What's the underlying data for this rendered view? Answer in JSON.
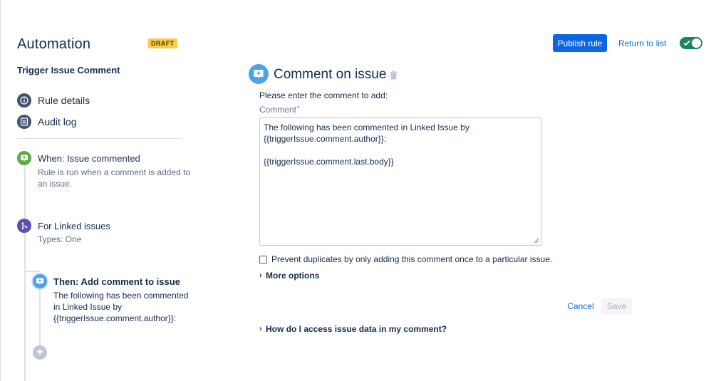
{
  "header": {
    "title": "Automation",
    "badge": "DRAFT",
    "rule_name": "Trigger Issue Comment",
    "publish_label": "Publish rule",
    "return_label": "Return to list",
    "toggle_on": true
  },
  "nav": {
    "items": [
      {
        "label": "Rule details",
        "icon": "info-icon"
      },
      {
        "label": "Audit log",
        "icon": "list-icon"
      }
    ]
  },
  "steps": {
    "trigger": {
      "title": "When: Issue commented",
      "desc_line1": "Rule is run when a comment is added to",
      "desc_line2": "an issue.",
      "color": "#5aac44"
    },
    "branch": {
      "title": "For Linked issues",
      "desc": "Types: One",
      "color": "#5e4db2"
    },
    "action": {
      "title": "Then: Add comment to issue",
      "desc_line1": "The following has been commented",
      "desc_line2": "in Linked Issue by",
      "desc_line3": "{{triggerIssue.comment.author}}:",
      "color": "#4fa3e0"
    }
  },
  "panel": {
    "title": "Comment on issue",
    "instructions": "Please enter the comment to add:",
    "comment_label": "Comment",
    "required_mark": "*",
    "comment_value": "The following has been commented in Linked Issue by\n{{triggerIssue.comment.author}}:\n\n{{triggerIssue.comment.last.body}}",
    "prevent_duplicates_label": "Prevent duplicates by only adding this comment once to a particular issue.",
    "prevent_duplicates_checked": false,
    "more_options_label": "More options",
    "cancel_label": "Cancel",
    "save_label": "Save",
    "help_label": "How do I access issue data in my comment?"
  }
}
